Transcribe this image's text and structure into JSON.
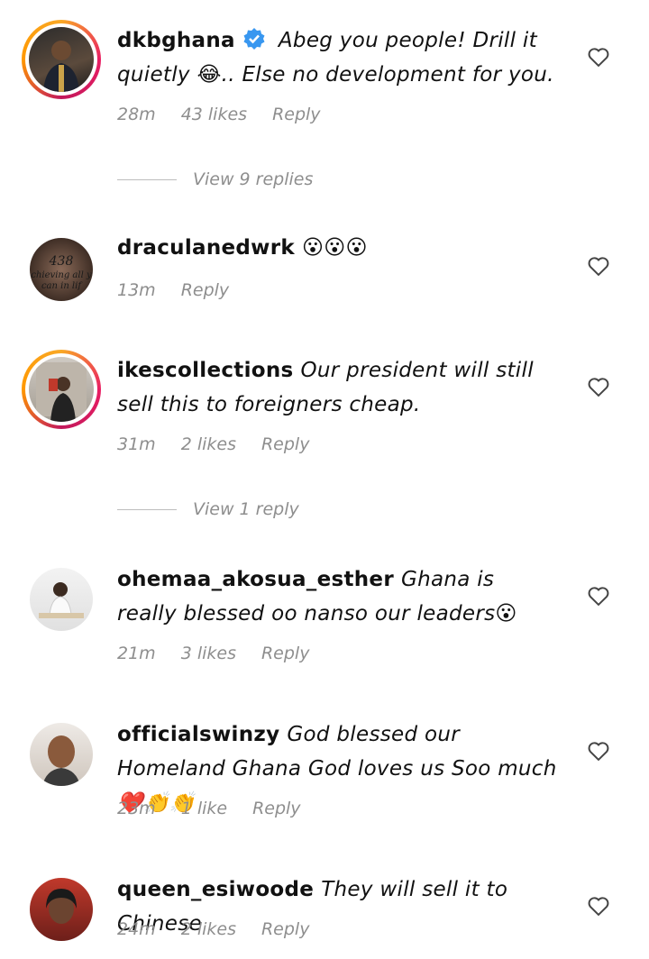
{
  "comments": [
    {
      "user": "dkbghana",
      "verified": true,
      "text": "Abeg you people! Drill it quietly 😂.. Else no development for you.",
      "time": "28m",
      "likes": "43 likes",
      "reply": "Reply",
      "view_replies": "View 9 replies"
    },
    {
      "user": "draculanedwrk",
      "verified": false,
      "text": "😮😮😮",
      "time": "13m",
      "likes": "",
      "reply": "Reply",
      "avatar_text": "438 chieving all y can in lif"
    },
    {
      "user": "ikescollections",
      "verified": false,
      "text": "Our president will still sell this to foreigners cheap.",
      "time": "31m",
      "likes": "2 likes",
      "reply": "Reply",
      "view_replies": "View 1 reply"
    },
    {
      "user": "ohemaa_akosua_esther",
      "verified": false,
      "text": "Ghana is really blessed oo nanso our leaders😮",
      "time": "21m",
      "likes": "3 likes",
      "reply": "Reply"
    },
    {
      "user": "officialswinzy",
      "verified": false,
      "text": "God blessed our Homeland Ghana God loves us Soo much❤️👏👏",
      "time": "23m",
      "likes": "1 like",
      "reply": "Reply"
    },
    {
      "user": "queen_esiwoode",
      "verified": false,
      "text": "They will sell it to Chinese",
      "time": "24m",
      "likes": "2 likes",
      "reply": "Reply"
    }
  ],
  "colors": {
    "verified": "#3897f0",
    "meta": "#8e8e8e",
    "ring_start": "#f9a825",
    "ring_end": "#c2185b"
  },
  "icons": {
    "like": "heart-outline-icon",
    "verified": "verified-badge-icon"
  }
}
